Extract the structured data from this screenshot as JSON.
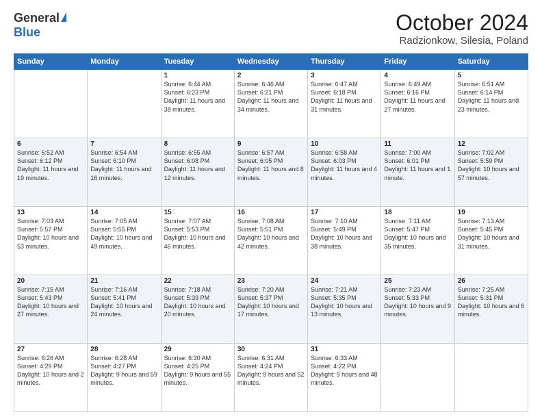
{
  "header": {
    "logo_general": "General",
    "logo_blue": "Blue",
    "month_title": "October 2024",
    "location": "Radzionkow, Silesia, Poland"
  },
  "days_of_week": [
    "Sunday",
    "Monday",
    "Tuesday",
    "Wednesday",
    "Thursday",
    "Friday",
    "Saturday"
  ],
  "weeks": [
    [
      {
        "day": "",
        "info": ""
      },
      {
        "day": "",
        "info": ""
      },
      {
        "day": "1",
        "info": "Sunrise: 6:44 AM\nSunset: 6:23 PM\nDaylight: 11 hours\nand 38 minutes."
      },
      {
        "day": "2",
        "info": "Sunrise: 6:46 AM\nSunset: 6:21 PM\nDaylight: 11 hours\nand 34 minutes."
      },
      {
        "day": "3",
        "info": "Sunrise: 6:47 AM\nSunset: 6:18 PM\nDaylight: 11 hours\nand 31 minutes."
      },
      {
        "day": "4",
        "info": "Sunrise: 6:49 AM\nSunset: 6:16 PM\nDaylight: 11 hours\nand 27 minutes."
      },
      {
        "day": "5",
        "info": "Sunrise: 6:51 AM\nSunset: 6:14 PM\nDaylight: 11 hours\nand 23 minutes."
      }
    ],
    [
      {
        "day": "6",
        "info": "Sunrise: 6:52 AM\nSunset: 6:12 PM\nDaylight: 11 hours\nand 19 minutes."
      },
      {
        "day": "7",
        "info": "Sunrise: 6:54 AM\nSunset: 6:10 PM\nDaylight: 11 hours\nand 16 minutes."
      },
      {
        "day": "8",
        "info": "Sunrise: 6:55 AM\nSunset: 6:08 PM\nDaylight: 11 hours\nand 12 minutes."
      },
      {
        "day": "9",
        "info": "Sunrise: 6:57 AM\nSunset: 6:05 PM\nDaylight: 11 hours\nand 8 minutes."
      },
      {
        "day": "10",
        "info": "Sunrise: 6:58 AM\nSunset: 6:03 PM\nDaylight: 11 hours\nand 4 minutes."
      },
      {
        "day": "11",
        "info": "Sunrise: 7:00 AM\nSunset: 6:01 PM\nDaylight: 11 hours\nand 1 minute."
      },
      {
        "day": "12",
        "info": "Sunrise: 7:02 AM\nSunset: 5:59 PM\nDaylight: 10 hours\nand 57 minutes."
      }
    ],
    [
      {
        "day": "13",
        "info": "Sunrise: 7:03 AM\nSunset: 5:57 PM\nDaylight: 10 hours\nand 53 minutes."
      },
      {
        "day": "14",
        "info": "Sunrise: 7:05 AM\nSunset: 5:55 PM\nDaylight: 10 hours\nand 49 minutes."
      },
      {
        "day": "15",
        "info": "Sunrise: 7:07 AM\nSunset: 5:53 PM\nDaylight: 10 hours\nand 46 minutes."
      },
      {
        "day": "16",
        "info": "Sunrise: 7:08 AM\nSunset: 5:51 PM\nDaylight: 10 hours\nand 42 minutes."
      },
      {
        "day": "17",
        "info": "Sunrise: 7:10 AM\nSunset: 5:49 PM\nDaylight: 10 hours\nand 38 minutes."
      },
      {
        "day": "18",
        "info": "Sunrise: 7:11 AM\nSunset: 5:47 PM\nDaylight: 10 hours\nand 35 minutes."
      },
      {
        "day": "19",
        "info": "Sunrise: 7:13 AM\nSunset: 5:45 PM\nDaylight: 10 hours\nand 31 minutes."
      }
    ],
    [
      {
        "day": "20",
        "info": "Sunrise: 7:15 AM\nSunset: 5:43 PM\nDaylight: 10 hours\nand 27 minutes."
      },
      {
        "day": "21",
        "info": "Sunrise: 7:16 AM\nSunset: 5:41 PM\nDaylight: 10 hours\nand 24 minutes."
      },
      {
        "day": "22",
        "info": "Sunrise: 7:18 AM\nSunset: 5:39 PM\nDaylight: 10 hours\nand 20 minutes."
      },
      {
        "day": "23",
        "info": "Sunrise: 7:20 AM\nSunset: 5:37 PM\nDaylight: 10 hours\nand 17 minutes."
      },
      {
        "day": "24",
        "info": "Sunrise: 7:21 AM\nSunset: 5:35 PM\nDaylight: 10 hours\nand 13 minutes."
      },
      {
        "day": "25",
        "info": "Sunrise: 7:23 AM\nSunset: 5:33 PM\nDaylight: 10 hours\nand 9 minutes."
      },
      {
        "day": "26",
        "info": "Sunrise: 7:25 AM\nSunset: 5:31 PM\nDaylight: 10 hours\nand 6 minutes."
      }
    ],
    [
      {
        "day": "27",
        "info": "Sunrise: 6:26 AM\nSunset: 4:29 PM\nDaylight: 10 hours\nand 2 minutes."
      },
      {
        "day": "28",
        "info": "Sunrise: 6:28 AM\nSunset: 4:27 PM\nDaylight: 9 hours\nand 59 minutes."
      },
      {
        "day": "29",
        "info": "Sunrise: 6:30 AM\nSunset: 4:25 PM\nDaylight: 9 hours\nand 55 minutes."
      },
      {
        "day": "30",
        "info": "Sunrise: 6:31 AM\nSunset: 4:24 PM\nDaylight: 9 hours\nand 52 minutes."
      },
      {
        "day": "31",
        "info": "Sunrise: 6:33 AM\nSunset: 4:22 PM\nDaylight: 9 hours\nand 48 minutes."
      },
      {
        "day": "",
        "info": ""
      },
      {
        "day": "",
        "info": ""
      }
    ]
  ]
}
